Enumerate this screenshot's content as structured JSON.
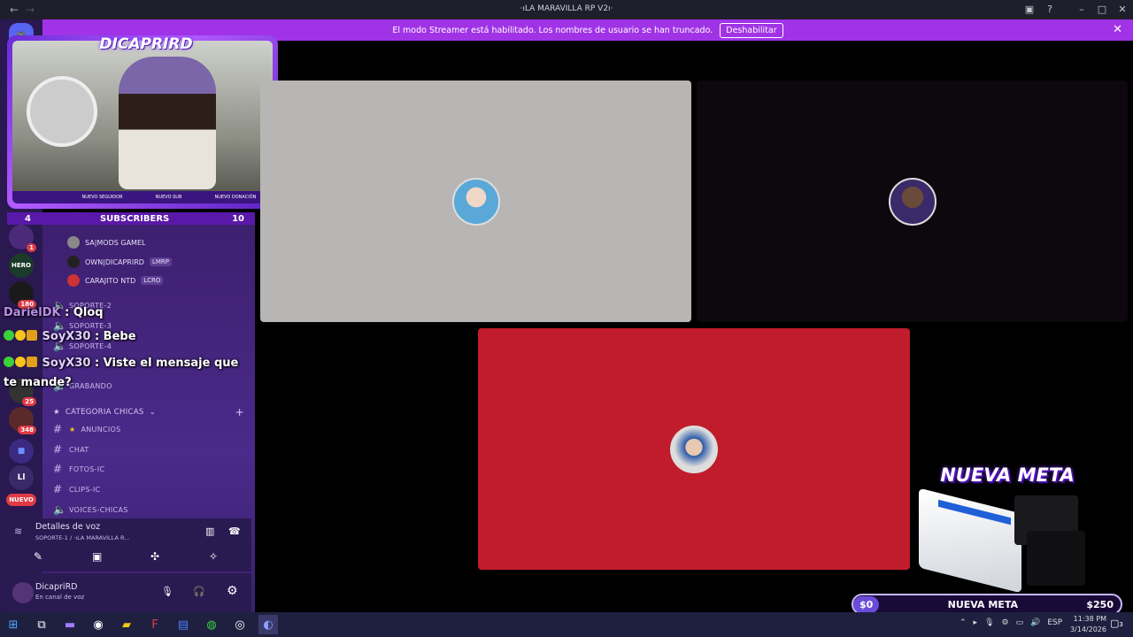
{
  "window": {
    "title": "·ıLA MARAVILLA RP V2ı·"
  },
  "banner": {
    "message": "El modo Streamer está habilitado. Los nombres de usuario se han truncado.",
    "disable_label": "Deshabilitar"
  },
  "overlay": {
    "streamer_name": "DICAPRIRD",
    "cam_tags": [
      "NUEVO SEGUIDOR",
      "NUEVO SUB",
      "NUEVO DONACIÓN"
    ],
    "subs_label": "SUBSCRIBERS",
    "subs_current": "4",
    "subs_goal": "10"
  },
  "members": [
    {
      "name": "SA|MODS GAMEL",
      "tag": ""
    },
    {
      "name": "OWN|DICAPRIRD",
      "tag": "LMRP"
    },
    {
      "name": "CARAJITO NTD",
      "tag": "LCRO"
    }
  ],
  "channels": [
    {
      "name": "SOPORTE-2"
    },
    {
      "name": "SOPORTE-3"
    },
    {
      "name": "SOPORTE-4"
    },
    {
      "name": "GRABANDO"
    }
  ],
  "category": {
    "name": "CATEGORIA CHICAS"
  },
  "category_channels": [
    {
      "name": "ANUNCIOS"
    },
    {
      "name": "CHAT"
    },
    {
      "name": "FOTOS-IC"
    },
    {
      "name": "CLIPS-IC"
    },
    {
      "name": "VOICES-CHICAS"
    }
  ],
  "chat": [
    {
      "user": "DarielDK",
      "text": " : Qloq"
    },
    {
      "user": "SoyX30",
      "text": " : Bebe"
    },
    {
      "user": "SoyX30",
      "text": " : Viste el mensaje que te mande?"
    }
  ],
  "server_badges": {
    "b1": "1",
    "b2": "180",
    "b3": "25",
    "b4": "348",
    "new": "NUEVO",
    "ll": "Ll"
  },
  "voice": {
    "title": "Detalles de voz",
    "subtitle": "SOPORTE-1 / ·ıLA MARAVILLA R..."
  },
  "user": {
    "name": "DicapriRD",
    "status": "En canal de voz"
  },
  "meta": {
    "title": "NUEVA META",
    "bar_label": "NUEVA META",
    "min": "$0",
    "max": "$250",
    "progress": 0
  },
  "taskbar": {
    "time": "11:38 PM",
    "date": "3/14/2026",
    "lang": "ESP",
    "notif": "3"
  },
  "colors": {
    "accent": "#a133e6",
    "tile_gray": "#b8b6b5",
    "tile_red": "#c01c2b"
  }
}
